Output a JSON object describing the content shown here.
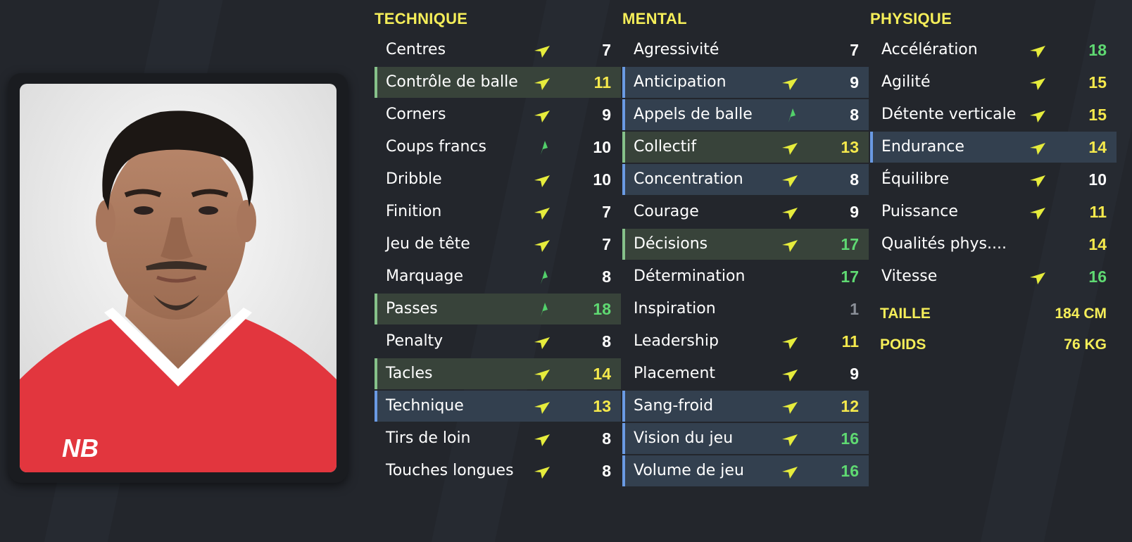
{
  "columns": {
    "technique": {
      "title": "TECHNIQUE",
      "attributes": [
        {
          "label": "Centres",
          "value": "7",
          "arrow": "up-right",
          "tone": "white",
          "highlight": "none"
        },
        {
          "label": "Contrôle de balle",
          "value": "11",
          "arrow": "up-right",
          "tone": "yellow",
          "highlight": "green"
        },
        {
          "label": "Corners",
          "value": "9",
          "arrow": "up-right",
          "tone": "white",
          "highlight": "none"
        },
        {
          "label": "Coups francs",
          "value": "10",
          "arrow": "up",
          "tone": "white",
          "highlight": "none"
        },
        {
          "label": "Dribble",
          "value": "10",
          "arrow": "up-right",
          "tone": "white",
          "highlight": "none"
        },
        {
          "label": "Finition",
          "value": "7",
          "arrow": "up-right",
          "tone": "white",
          "highlight": "none"
        },
        {
          "label": "Jeu de tête",
          "value": "7",
          "arrow": "up-right",
          "tone": "white",
          "highlight": "none"
        },
        {
          "label": "Marquage",
          "value": "8",
          "arrow": "up",
          "tone": "white",
          "highlight": "none"
        },
        {
          "label": "Passes",
          "value": "18",
          "arrow": "up",
          "tone": "green",
          "highlight": "green"
        },
        {
          "label": "Penalty",
          "value": "8",
          "arrow": "up-right",
          "tone": "white",
          "highlight": "none"
        },
        {
          "label": "Tacles",
          "value": "14",
          "arrow": "up-right",
          "tone": "yellow",
          "highlight": "green"
        },
        {
          "label": "Technique",
          "value": "13",
          "arrow": "up-right",
          "tone": "yellow",
          "highlight": "blue"
        },
        {
          "label": "Tirs de loin",
          "value": "8",
          "arrow": "up-right",
          "tone": "white",
          "highlight": "none"
        },
        {
          "label": "Touches longues",
          "value": "8",
          "arrow": "up-right",
          "tone": "white",
          "highlight": "none"
        }
      ]
    },
    "mental": {
      "title": "MENTAL",
      "attributes": [
        {
          "label": "Agressivité",
          "value": "7",
          "arrow": "none",
          "tone": "white",
          "highlight": "none"
        },
        {
          "label": "Anticipation",
          "value": "9",
          "arrow": "up-right",
          "tone": "white",
          "highlight": "blue"
        },
        {
          "label": "Appels de balle",
          "value": "8",
          "arrow": "up",
          "tone": "white",
          "highlight": "blue"
        },
        {
          "label": "Collectif",
          "value": "13",
          "arrow": "up-right",
          "tone": "yellow",
          "highlight": "green"
        },
        {
          "label": "Concentration",
          "value": "8",
          "arrow": "up-right",
          "tone": "white",
          "highlight": "blue"
        },
        {
          "label": "Courage",
          "value": "9",
          "arrow": "up-right",
          "tone": "white",
          "highlight": "none"
        },
        {
          "label": "Décisions",
          "value": "17",
          "arrow": "up-right",
          "tone": "green",
          "highlight": "green"
        },
        {
          "label": "Détermination",
          "value": "17",
          "arrow": "none",
          "tone": "green",
          "highlight": "none"
        },
        {
          "label": "Inspiration",
          "value": "1",
          "arrow": "none",
          "tone": "grey",
          "highlight": "none"
        },
        {
          "label": "Leadership",
          "value": "11",
          "arrow": "up-right",
          "tone": "yellow",
          "highlight": "none"
        },
        {
          "label": "Placement",
          "value": "9",
          "arrow": "up-right",
          "tone": "white",
          "highlight": "none"
        },
        {
          "label": "Sang-froid",
          "value": "12",
          "arrow": "up-right",
          "tone": "yellow",
          "highlight": "blue"
        },
        {
          "label": "Vision du jeu",
          "value": "16",
          "arrow": "up-right",
          "tone": "green",
          "highlight": "blue"
        },
        {
          "label": "Volume de jeu",
          "value": "16",
          "arrow": "up-right",
          "tone": "green",
          "highlight": "blue"
        }
      ]
    },
    "physique": {
      "title": "PHYSIQUE",
      "attributes": [
        {
          "label": "Accélération",
          "value": "18",
          "arrow": "up-right",
          "tone": "green",
          "highlight": "none"
        },
        {
          "label": "Agilité",
          "value": "15",
          "arrow": "up-right",
          "tone": "yellow",
          "highlight": "none"
        },
        {
          "label": "Détente verticale",
          "value": "15",
          "arrow": "up-right",
          "tone": "yellow",
          "highlight": "none"
        },
        {
          "label": "Endurance",
          "value": "14",
          "arrow": "up-right",
          "tone": "yellow",
          "highlight": "blue"
        },
        {
          "label": "Équilibre",
          "value": "10",
          "arrow": "up-right",
          "tone": "white",
          "highlight": "none"
        },
        {
          "label": "Puissance",
          "value": "11",
          "arrow": "up-right",
          "tone": "yellow",
          "highlight": "none"
        },
        {
          "label": "Qualités phys....",
          "value": "14",
          "arrow": "none",
          "tone": "yellow",
          "highlight": "none"
        },
        {
          "label": "Vitesse",
          "value": "16",
          "arrow": "up-right",
          "tone": "green",
          "highlight": "none"
        }
      ]
    }
  },
  "body_info": {
    "height_label": "TAILLE",
    "height_value": "184 CM",
    "weight_label": "POIDS",
    "weight_value": "76 KG"
  },
  "colors": {
    "background": "#23262c",
    "title_yellow": "#f5ee59",
    "value_yellow": "#f5e94c",
    "value_green": "#5fd972",
    "highlight_green": "#38433a",
    "highlight_blue": "#33404f",
    "arrow_yellow": "#e6ec3c",
    "arrow_green": "#52d06a"
  },
  "icons": {
    "arrow_up_right": "trend-up-right-icon",
    "arrow_up": "trend-up-icon"
  }
}
